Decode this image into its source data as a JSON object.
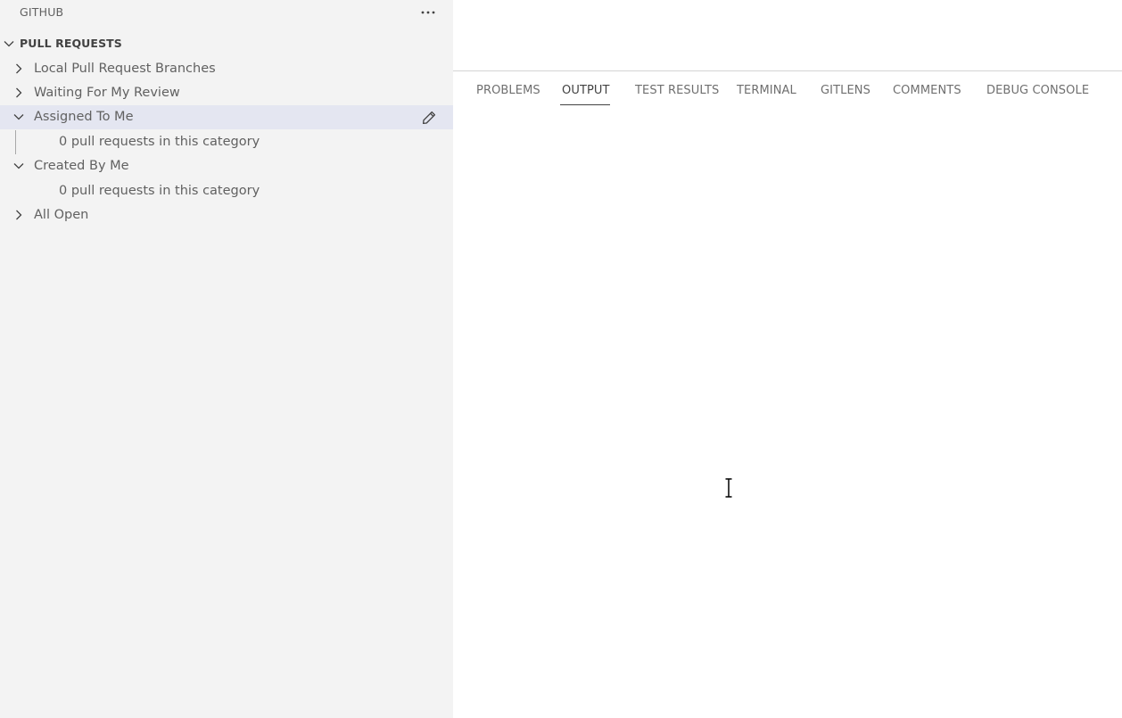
{
  "sidebar": {
    "view_title": "GITHUB",
    "more_actions_icon": "ellipsis-icon",
    "section": {
      "title": "PULL REQUESTS",
      "expanded": true
    },
    "tree": [
      {
        "label": "Local Pull Request Branches",
        "expanded": false,
        "level": 0
      },
      {
        "label": "Waiting For My Review",
        "expanded": false,
        "level": 0
      },
      {
        "label": "Assigned To Me",
        "expanded": true,
        "level": 0,
        "selected": true,
        "action_icon": "pencil-icon"
      },
      {
        "label": "0 pull requests in this category",
        "level": 1
      },
      {
        "label": "Created By Me",
        "expanded": true,
        "level": 0
      },
      {
        "label": "0 pull requests in this category",
        "level": 1
      },
      {
        "label": "All Open",
        "expanded": false,
        "level": 0
      }
    ]
  },
  "panel": {
    "tabs": [
      {
        "label": "PROBLEMS",
        "active": false
      },
      {
        "label": "OUTPUT",
        "active": true
      },
      {
        "label": "TEST RESULTS",
        "active": false
      },
      {
        "label": "TERMINAL",
        "active": false
      },
      {
        "label": "GITLENS",
        "active": false
      },
      {
        "label": "COMMENTS",
        "active": false
      },
      {
        "label": "DEBUG CONSOLE",
        "active": false
      }
    ]
  },
  "colors": {
    "sidebar_bg": "#f3f3f3",
    "selected_row_bg": "#e4e6f1",
    "text": "#616161",
    "active_tab": "#424242"
  }
}
